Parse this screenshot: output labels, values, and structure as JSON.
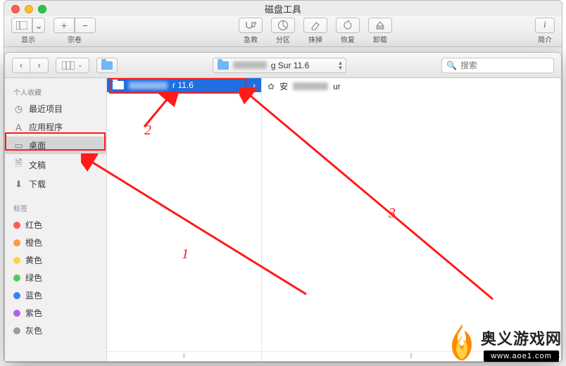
{
  "disk_utility": {
    "title": "磁盘工具",
    "toolbar": {
      "view": {
        "label": "显示"
      },
      "volume": {
        "label": "宗卷",
        "plus": "+",
        "minus": "−"
      },
      "first_aid": {
        "label": "急救"
      },
      "partition": {
        "label": "分区"
      },
      "erase": {
        "label": "抹掉"
      },
      "restore": {
        "label": "恢复"
      },
      "unmount": {
        "label": "卸载"
      },
      "info": {
        "label": "简介"
      }
    }
  },
  "finder": {
    "path_popup": {
      "suffix": "g Sur 11.6"
    },
    "search": {
      "placeholder": "搜索"
    },
    "sidebar": {
      "favorites_header": "个人收藏",
      "items": [
        {
          "icon": "clock",
          "label": "最近项目"
        },
        {
          "icon": "app",
          "label": "应用程序"
        },
        {
          "icon": "desktop",
          "label": "桌面",
          "selected": true
        },
        {
          "icon": "doc",
          "label": "文稿"
        },
        {
          "icon": "download",
          "label": "下载"
        }
      ],
      "tags_header": "标签",
      "tags": [
        {
          "color": "#ff5b55",
          "label": "红色"
        },
        {
          "color": "#ff9a3d",
          "label": "橙色"
        },
        {
          "color": "#ffd23a",
          "label": "黄色"
        },
        {
          "color": "#4fcb57",
          "label": "绿色"
        },
        {
          "color": "#3b82f3",
          "label": "蓝色"
        },
        {
          "color": "#b062e6",
          "label": "紫色"
        },
        {
          "color": "#9c9c9c",
          "label": "灰色"
        }
      ]
    },
    "column1": {
      "item": {
        "suffix": "r 11.6",
        "selected": true
      }
    },
    "column2": {
      "item": {
        "prefix": "安",
        "suffix": "ur"
      }
    }
  },
  "annotations": {
    "a1": "1",
    "a2": "2",
    "a3": "3"
  },
  "watermark": {
    "cn": "奥义游戏网",
    "url": "www.aoe1.com"
  }
}
